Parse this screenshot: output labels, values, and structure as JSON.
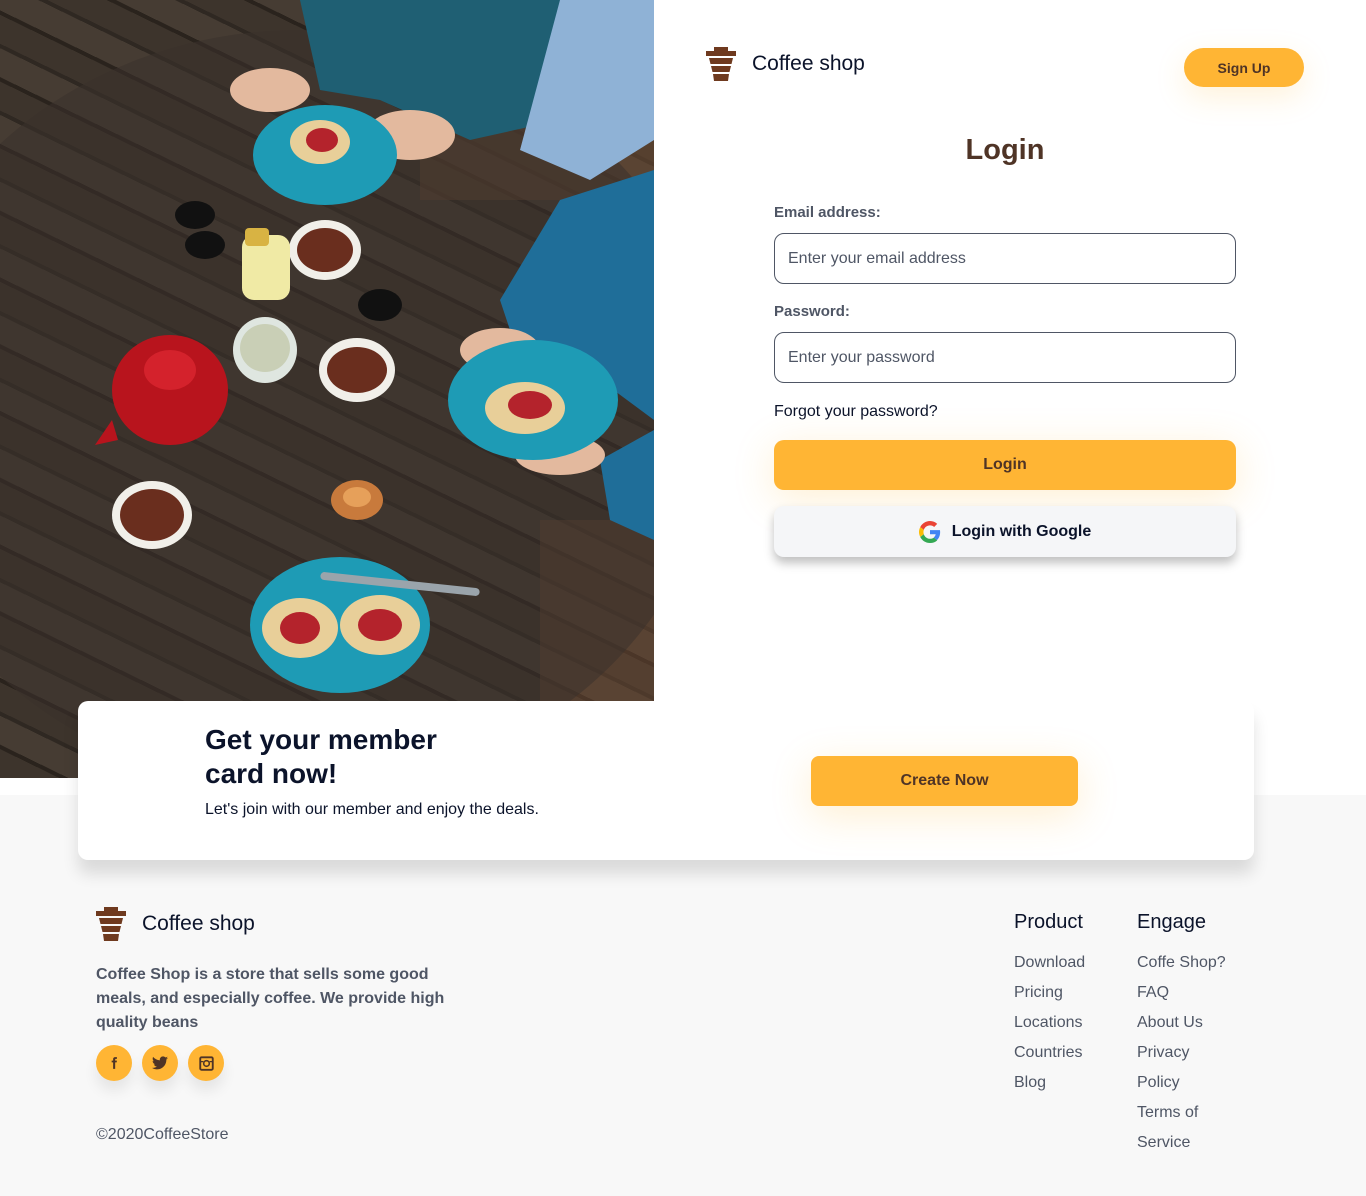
{
  "header": {
    "brand_name": "Coffee shop",
    "signup_label": "Sign Up"
  },
  "login": {
    "title": "Login",
    "email_label": "Email address:",
    "email_placeholder": "Enter your email address",
    "password_label": "Password:",
    "password_placeholder": "Enter your password",
    "forgot_label": "Forgot your password?",
    "login_button": "Login",
    "google_button": "Login with Google"
  },
  "member": {
    "title": "Get your member card now!",
    "subtitle": "Let's join with our member and enjoy the deals.",
    "button": "Create Now"
  },
  "footer": {
    "brand_name": "Coffee shop",
    "description": "Coffee Shop is a store that sells some good meals, and especially coffee. We provide high quality beans",
    "copyright": "©2020CoffeeStore",
    "product": {
      "title": "Product",
      "links": [
        "Download",
        "Pricing",
        "Locations",
        "Countries",
        "Blog"
      ]
    },
    "engage": {
      "title": "Engage",
      "links": [
        "Coffe Shop?",
        "FAQ",
        "About Us",
        "Privacy",
        "Policy",
        "Terms of",
        "Service"
      ]
    },
    "socials": [
      "facebook-icon",
      "twitter-icon",
      "instagram-icon"
    ]
  },
  "colors": {
    "accent": "#ffb534",
    "brown": "#4f3426",
    "text_dark": "#0b132a",
    "text_gray": "#4f5665",
    "footer_bg": "#f8f8f8"
  }
}
